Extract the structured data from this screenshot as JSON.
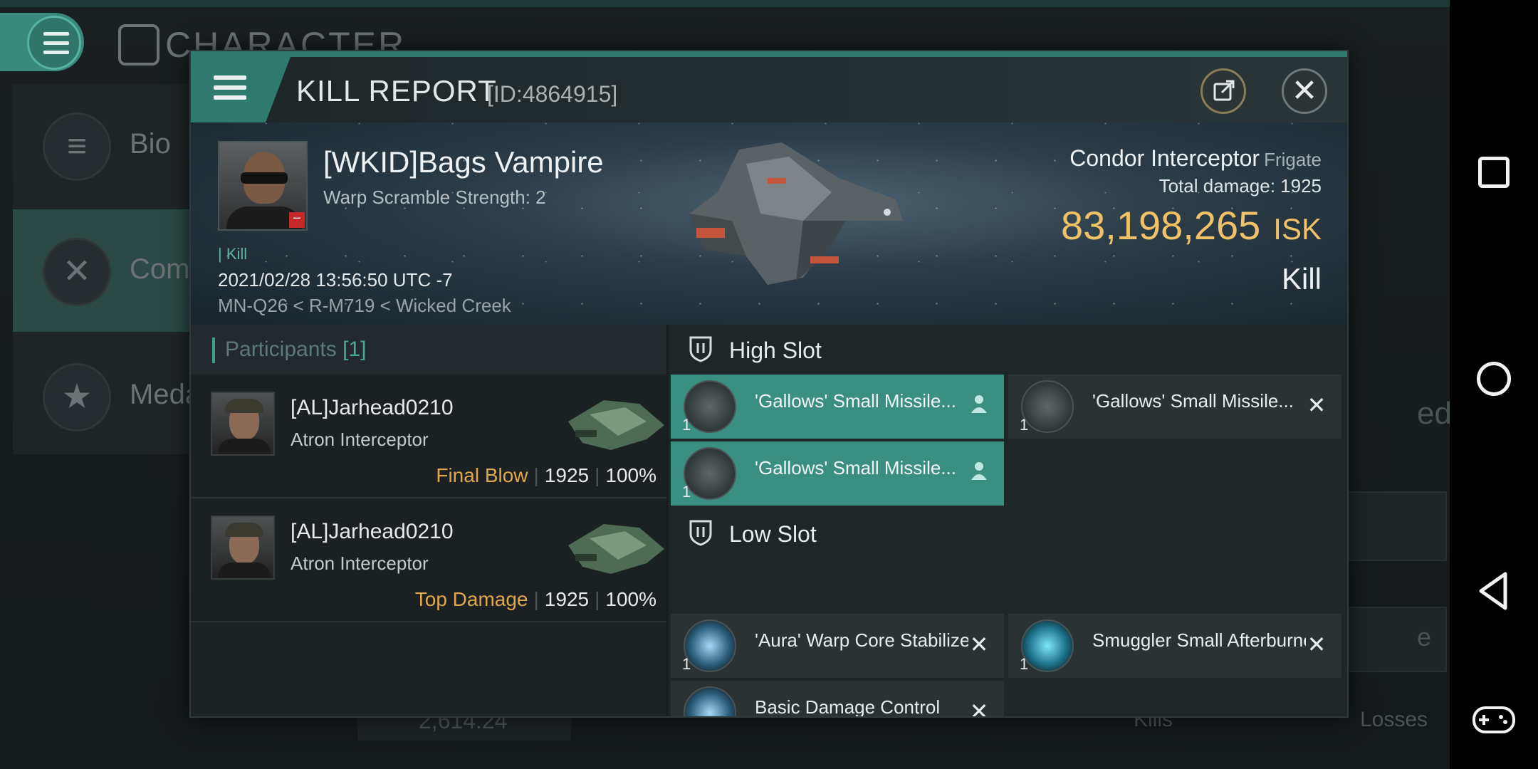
{
  "background": {
    "header_title": "CHARACTER",
    "side_items": [
      {
        "label": "Bio",
        "icon": "list-icon"
      },
      {
        "label": "Com",
        "icon": "crossed-swords-icon"
      },
      {
        "label": "Meda",
        "icon": "star-medal-icon"
      }
    ],
    "stat_value": "2,614.24",
    "ghost_text": "ed",
    "ghost_text2": "e",
    "kills_label": "Kills",
    "losses_label": "Losses"
  },
  "dialog": {
    "title": "KILL REPORT",
    "id_text": "[ID:4864915]"
  },
  "victim": {
    "name": "[WKID]Bags Vampire",
    "scramble": "Warp Scramble Strength: 2",
    "kill_tag": "Kill",
    "datetime": "2021/02/28 13:56:50 UTC -7",
    "location": "MN-Q26 < R-M719 < Wicked Creek",
    "ship_name": "Condor Interceptor",
    "ship_class": "Frigate",
    "total_damage_label": "Total damage:",
    "total_damage": "1925",
    "isk_value": "83,198,265",
    "isk_unit": "ISK",
    "kill_type": "Kill"
  },
  "participants": {
    "label": "Participants",
    "count": "[1]",
    "rows": [
      {
        "name": "[AL]Jarhead0210",
        "ship": "Atron Interceptor",
        "role": "Final Blow",
        "damage": "1925",
        "percent": "100%"
      },
      {
        "name": "[AL]Jarhead0210",
        "ship": "Atron Interceptor",
        "role": "Top Damage",
        "damage": "1925",
        "percent": "100%"
      }
    ]
  },
  "fitting": {
    "high_slot_label": "High Slot",
    "low_slot_label": "Low Slot",
    "high_modules": [
      {
        "name": "'Gallows' Small Missile...",
        "qty": "1",
        "state": "dropped",
        "icon": "missile-launcher-icon"
      },
      {
        "name": "'Gallows' Small Missile...",
        "qty": "1",
        "state": "destroyed",
        "icon": "missile-launcher-icon"
      },
      {
        "name": "'Gallows' Small Missile...",
        "qty": "1",
        "state": "dropped",
        "icon": "missile-launcher-icon"
      }
    ],
    "low_modules": [
      {
        "name": "'Aura' Warp Core Stabilizer",
        "qty": "1",
        "state": "destroyed",
        "icon": "warp-core-stabilizer-icon"
      },
      {
        "name": "Smuggler Small Afterburner",
        "qty": "1",
        "state": "destroyed",
        "icon": "afterburner-icon"
      },
      {
        "name": "Basic Damage Control",
        "qty": "1",
        "state": "destroyed",
        "icon": "damage-control-icon"
      }
    ]
  },
  "colors": {
    "accent": "#3a8f80",
    "isk_gold": "#f0c268",
    "role_gold": "#e0a84a"
  }
}
